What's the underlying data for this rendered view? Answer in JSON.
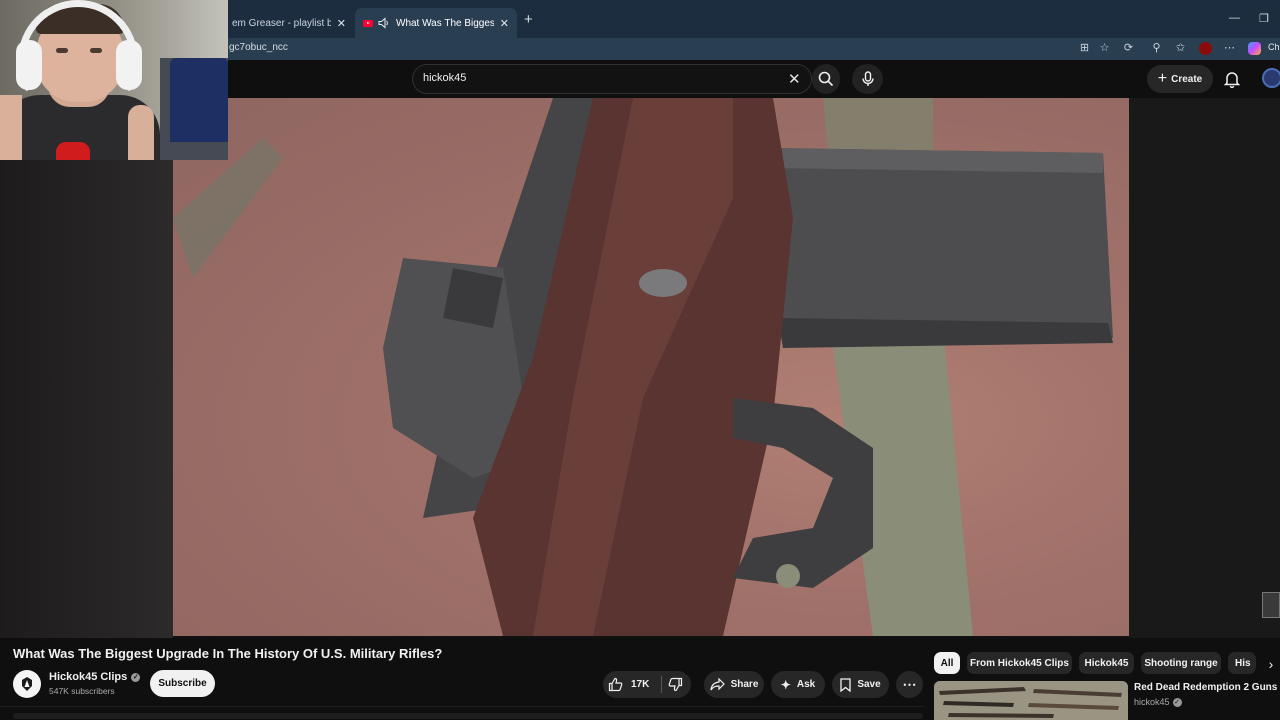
{
  "browser": {
    "tabs": [
      {
        "label": "em Greaser - playlist by Rich",
        "active": false
      },
      {
        "label": "What Was The Biggest Upgra",
        "active": true
      }
    ],
    "url": "gc7obuc_ncc",
    "copilot_label": "Ch"
  },
  "youtube": {
    "search": {
      "query": "hickok45"
    },
    "create_label": "Create"
  },
  "video": {
    "title": "What Was The Biggest Upgrade In The History Of U.S. Military Rifles?",
    "channel": {
      "name": "Hickok45 Clips",
      "subscribers": "547K subscribers"
    },
    "subscribe_label": "Subscribe",
    "actions": {
      "likes": "17K",
      "share": "Share",
      "ask": "Ask",
      "save": "Save"
    }
  },
  "sidebar": {
    "chips": [
      "All",
      "From Hickok45 Clips",
      "Hickok45",
      "Shooting range",
      "His"
    ],
    "recommendation": {
      "title": "Red Dead Redemption 2 Guns",
      "channel": "hickok45"
    }
  },
  "colors": {
    "background": "#0f0f0f",
    "tabbar": "#1c2d3f",
    "addressbar": "#2a3e52",
    "brand_red": "#ff0033"
  }
}
